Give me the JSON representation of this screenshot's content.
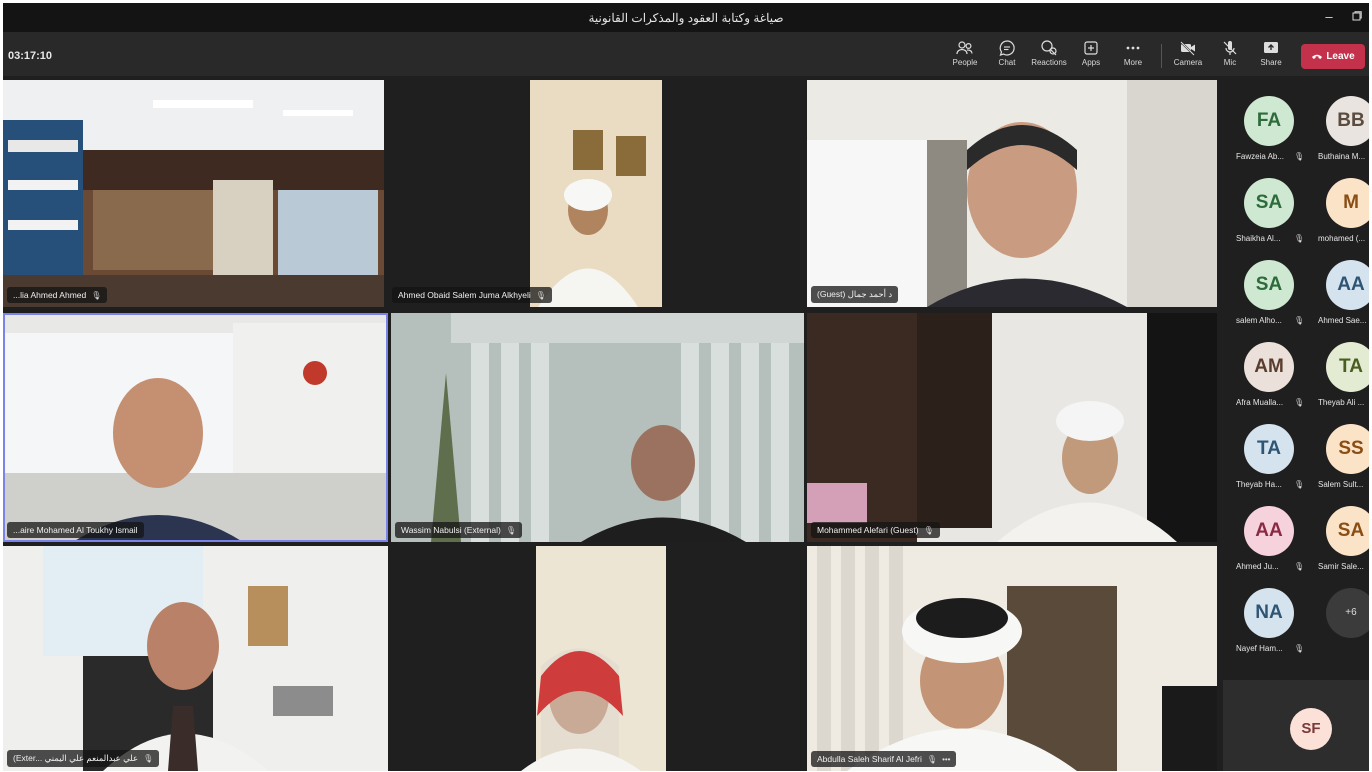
{
  "window": {
    "title": "صياغة وكتابة العقود والمذكرات القانونية"
  },
  "toolbar": {
    "timer": "03:17:10",
    "items": [
      "People",
      "Chat",
      "Reactions",
      "Apps",
      "More",
      "Camera",
      "Mic",
      "Share"
    ],
    "leave_label": "Leave"
  },
  "colors": {
    "leave": "#c4314b",
    "active_speaker_border": "#7b83eb"
  },
  "tiles": [
    {
      "name": "...lia Ahmed Ahmed"
    },
    {
      "name": "Ahmed Obaid Salem Juma Alkhyeli"
    },
    {
      "name": "(Guest) د أحمد جمال"
    },
    {
      "name": "...aire Mohamed Al Toukhy Ismail"
    },
    {
      "name": "Wassim Nabulsi (External)"
    },
    {
      "name": "Mohammed Alefari (Guest)"
    },
    {
      "name": "(Exter... علي عبدالمنعم علي اليمني"
    },
    {
      "name": ""
    },
    {
      "name": "Abdulla Saleh Sharif Al Jefri"
    }
  ],
  "roster": [
    {
      "initials": "FA",
      "label": "Fawzeia Ab...",
      "bg": "#cfe8d2",
      "fg": "#2e6b3a"
    },
    {
      "initials": "BB",
      "label": "Buthaina M...",
      "bg": "#e9e4df",
      "fg": "#5c4b3f"
    },
    {
      "initials": "SA",
      "label": "Shaikha Al...",
      "bg": "#cfe8d2",
      "fg": "#2e6b3a"
    },
    {
      "initials": "M",
      "label": "mohamed (...",
      "bg": "#fbe3c8",
      "fg": "#8a4e14"
    },
    {
      "initials": "SA",
      "label": "salem Alho...",
      "bg": "#cfe8d2",
      "fg": "#2e6b3a"
    },
    {
      "initials": "AA",
      "label": "Ahmed Sae...",
      "bg": "#d5e3ee",
      "fg": "#2f5574"
    },
    {
      "initials": "AM",
      "label": "Afra Mualla...",
      "bg": "#ebe1da",
      "fg": "#5a3d2e"
    },
    {
      "initials": "TA",
      "label": "Theyab Ali ...",
      "bg": "#e3ecd2",
      "fg": "#4a5e22"
    },
    {
      "initials": "TA",
      "label": "Theyab Ha...",
      "bg": "#d5e3ee",
      "fg": "#2f5574"
    },
    {
      "initials": "SS",
      "label": "Salem Sult...",
      "bg": "#fbe3c8",
      "fg": "#8a4e14"
    },
    {
      "initials": "AA",
      "label": "Ahmed Ju...",
      "bg": "#f6d3dc",
      "fg": "#8a2a44"
    },
    {
      "initials": "SA",
      "label": "Samir Sale...",
      "bg": "#fbe3c8",
      "fg": "#8a4e14"
    },
    {
      "initials": "NA",
      "label": "Nayef Ham...",
      "bg": "#d5e3ee",
      "fg": "#2f5574"
    }
  ],
  "overflow_label": "+6",
  "self_initials": "SF"
}
